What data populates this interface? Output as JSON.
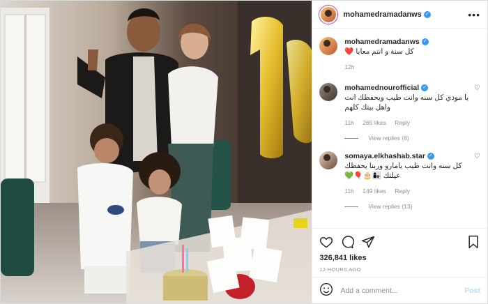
{
  "header": {
    "username": "mohamedramadanws",
    "more_label": "•••"
  },
  "caption": {
    "username": "mohamedramadanws",
    "text": "كل سنة و انتم معايا ❤️",
    "time": "12h"
  },
  "comments": [
    {
      "username": "mohamednourofficial",
      "text": "يا مودي كل سنه وانت طيب ويحفظك انت واهل بيتك كلهم",
      "time": "11h",
      "likes": "265 likes",
      "reply": "Reply",
      "view_replies": "View replies (8)"
    },
    {
      "username": "somaya.elkhashab.star",
      "text": "كل سنه وانت طيب يامارو وربنا يحفظك عيلتك 👩‍👧🎂🎈💚",
      "time": "11h",
      "likes": "149 likes",
      "reply": "Reply",
      "view_replies": "View replies (13)"
    }
  ],
  "actions": {
    "likes": "326,841 likes",
    "timestamp": "12 HOURS AGO"
  },
  "add_comment": {
    "placeholder": "Add a comment...",
    "post_label": "Post"
  },
  "colors": {
    "link_blue": "#3897f0",
    "post_disabled": "#b2dffc",
    "meta_gray": "#8e8e8e"
  }
}
